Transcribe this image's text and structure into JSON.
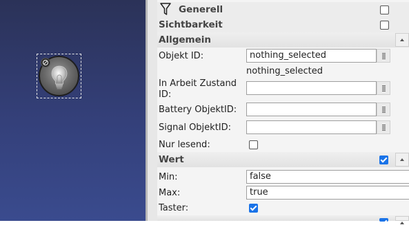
{
  "canvas": {
    "widget": {
      "icon": "lightbulb-icon",
      "badge_icon": "lock-icon"
    }
  },
  "panel": {
    "generell": {
      "title": "Generell",
      "icon": "filter-icon",
      "checked": false
    },
    "sichtbarkeit": {
      "title": "Sichtbarkeit",
      "checked": false
    },
    "allgemein": {
      "title": "Allgemein",
      "fields": {
        "objekt_id": {
          "label": "Objekt ID:",
          "value": "nothing_selected",
          "hint": "nothing_selected"
        },
        "in_arbeit": {
          "label_line1": "In Arbeit Zustand",
          "label_line2": "ID:",
          "value": ""
        },
        "battery": {
          "label": "Battery ObjektID:",
          "value": ""
        },
        "signal": {
          "label": "Signal ObjektID:",
          "value": ""
        },
        "nur_lesend": {
          "label": "Nur lesend:",
          "checked": false
        }
      }
    },
    "wert": {
      "title": "Wert",
      "checked": true,
      "fields": {
        "min": {
          "label": "Min:",
          "value": "false"
        },
        "max": {
          "label": "Max:",
          "value": "true"
        },
        "taster": {
          "label": "Taster:",
          "checked": true
        }
      }
    }
  },
  "colors": {
    "canvas_top": "#2b3258",
    "canvas_bottom": "#3a4b8e",
    "checkbox_checked": "#1a73e8"
  }
}
